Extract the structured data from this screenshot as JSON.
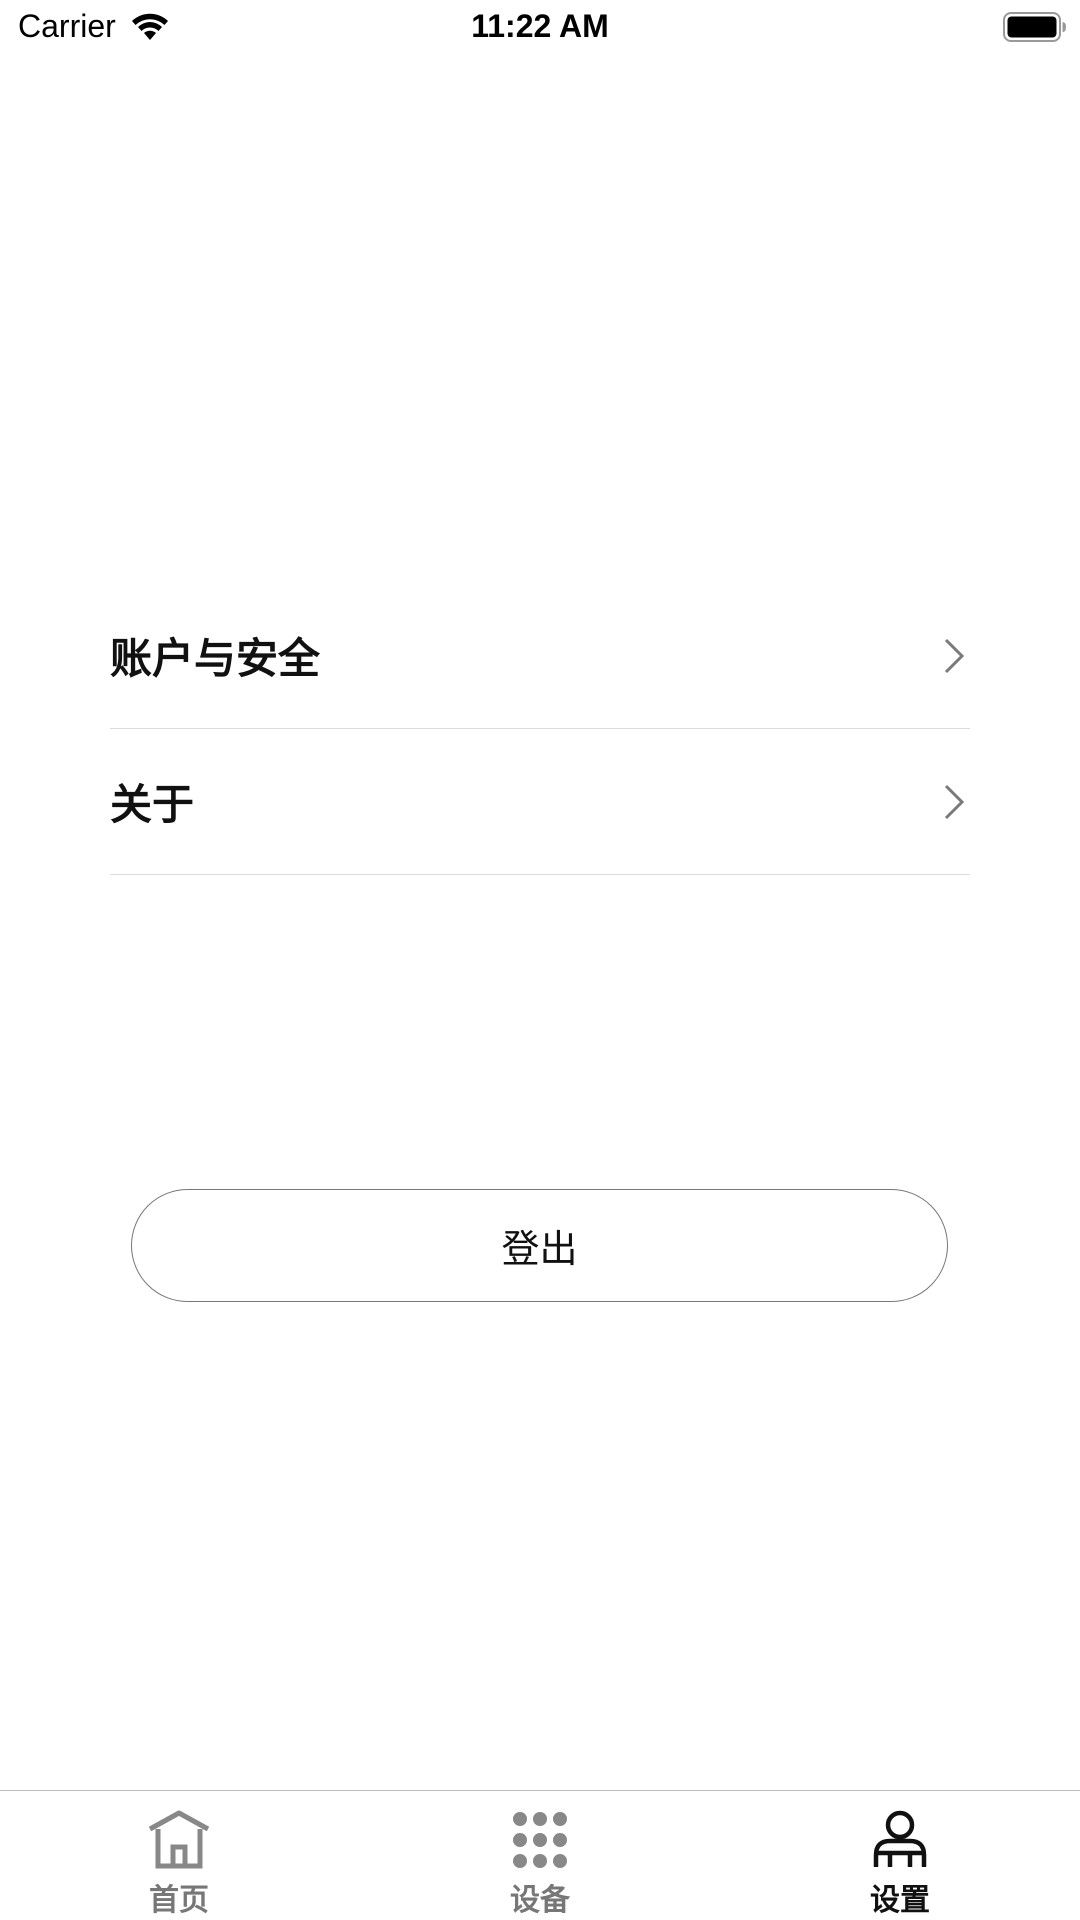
{
  "status_bar": {
    "carrier": "Carrier",
    "time": "11:22 AM",
    "icons": [
      "wifi-icon",
      "battery-icon"
    ]
  },
  "menu": {
    "items": [
      {
        "label": "账户与安全",
        "icon": "chevron-right-icon"
      },
      {
        "label": "关于",
        "icon": "chevron-right-icon"
      }
    ]
  },
  "logout": {
    "label": "登出"
  },
  "tab_bar": {
    "tabs": [
      {
        "label": "首页",
        "icon": "home-icon",
        "active": false
      },
      {
        "label": "设备",
        "icon": "grid-icon",
        "active": false
      },
      {
        "label": "设置",
        "icon": "person-icon",
        "active": true
      }
    ],
    "colors": {
      "active": "#111111",
      "inactive": "#777777"
    }
  }
}
